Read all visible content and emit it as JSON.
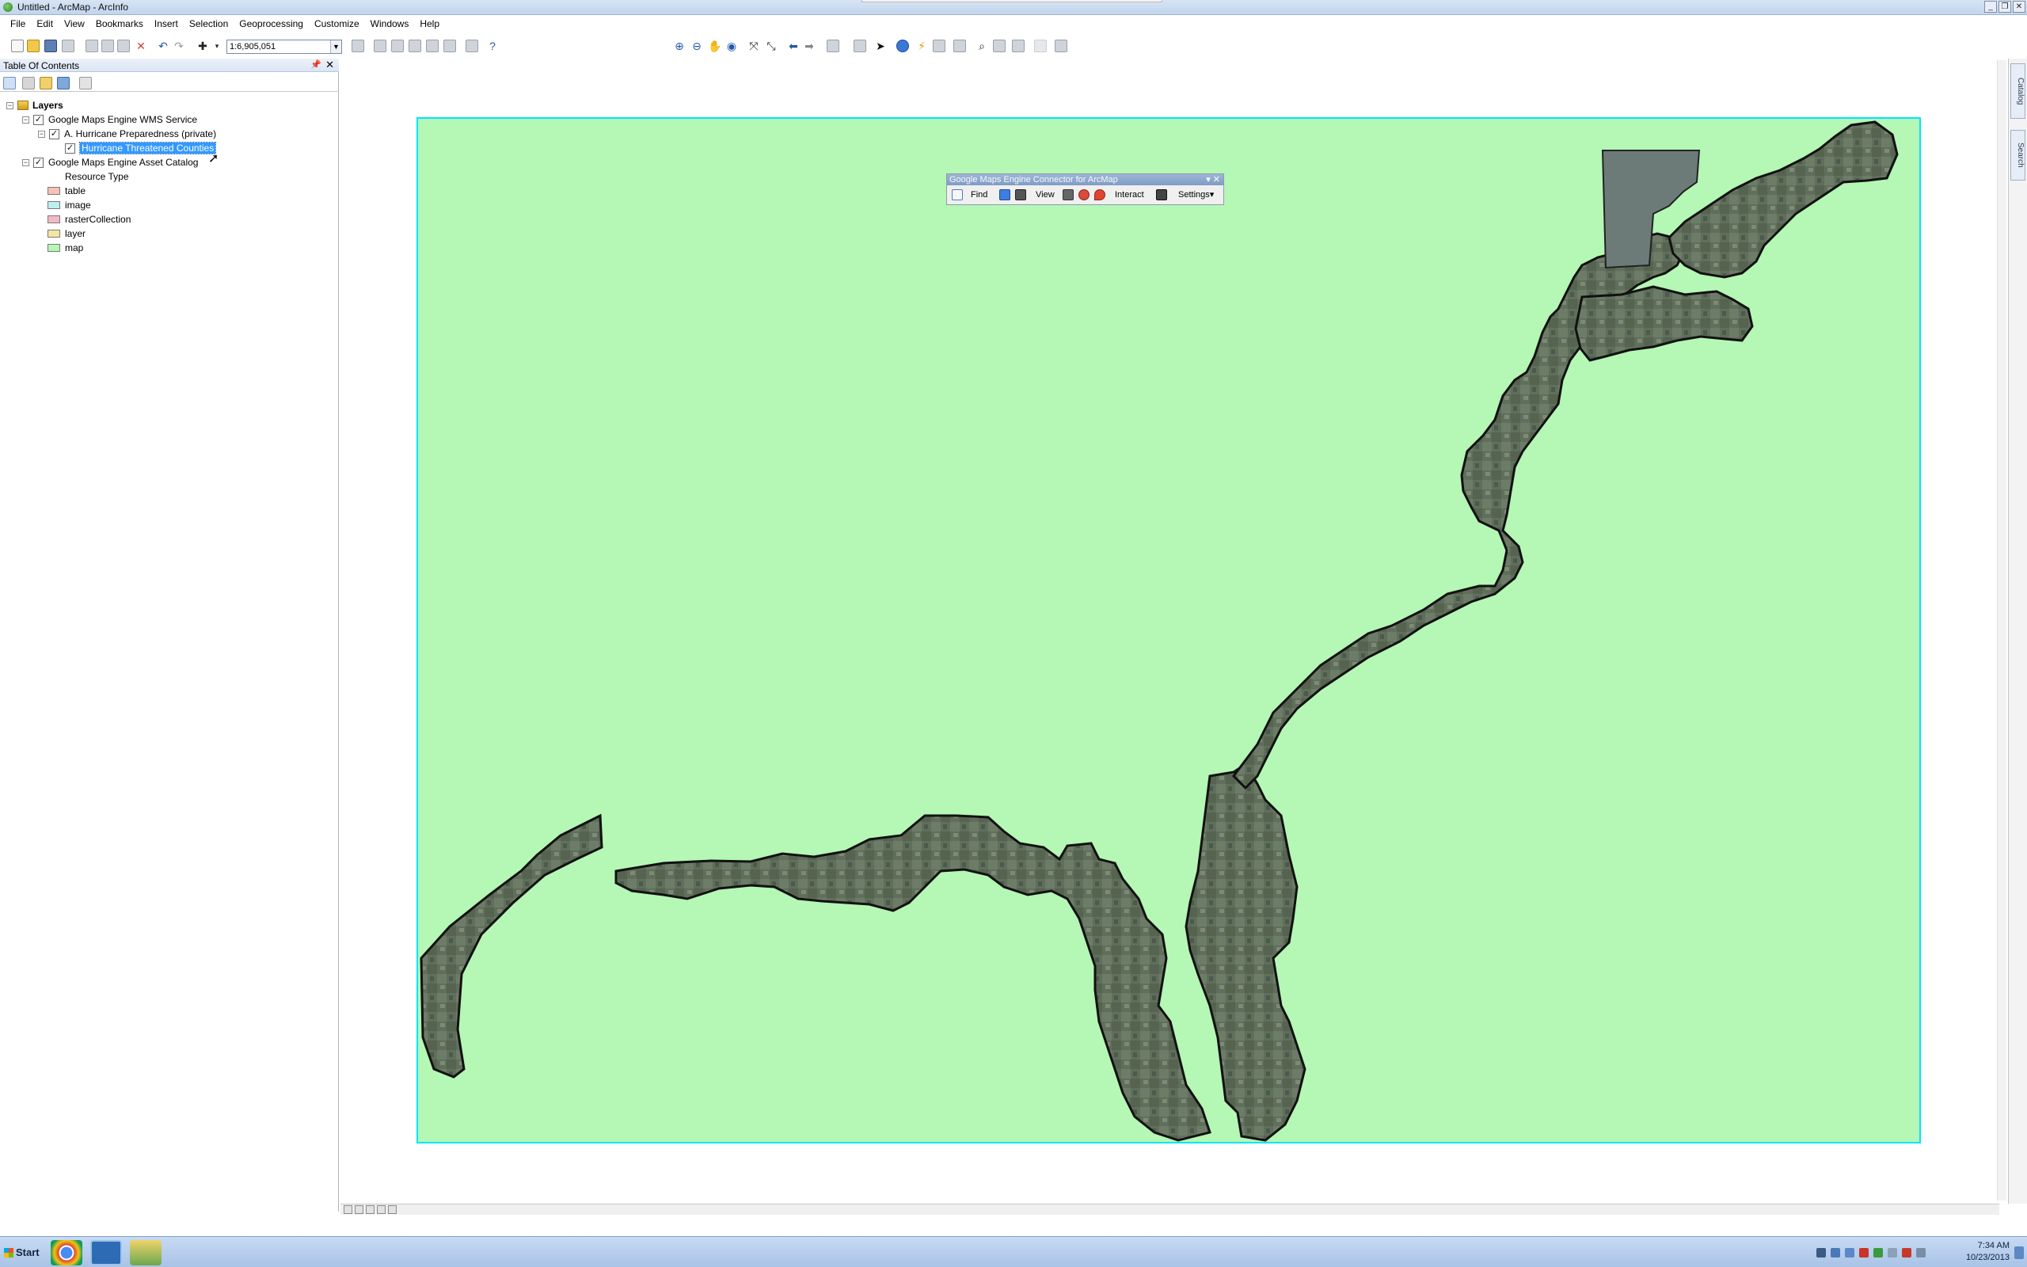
{
  "window": {
    "title": "Untitled - ArcMap - ArcInfo"
  },
  "menu": [
    "File",
    "Edit",
    "View",
    "Bookmarks",
    "Insert",
    "Selection",
    "Geoprocessing",
    "Customize",
    "Windows",
    "Help"
  ],
  "toolbar": {
    "scale_value": "1:6,905,051"
  },
  "toc": {
    "title": "Table Of Contents",
    "root_label": "Layers",
    "wms_service": "Google Maps Engine WMS Service",
    "group_layer": "A. Hurricane Preparedness (private)",
    "selected_layer": "Hurricane Threatened Counties",
    "asset_catalog": "Google Maps Engine Asset Catalog",
    "resource_type_label": "Resource Type",
    "legend": [
      {
        "label": "table",
        "color": "#f5c2b5"
      },
      {
        "label": "image",
        "color": "#bdeff2"
      },
      {
        "label": "rasterCollection",
        "color": "#f3b8c3"
      },
      {
        "label": "layer",
        "color": "#f3e5a3"
      },
      {
        "label": "map",
        "color": "#b5f7b5"
      }
    ]
  },
  "gme_toolbar": {
    "title": "Google Maps Engine Connector for ArcMap",
    "find": "Find",
    "view": "View",
    "interact": "Interact",
    "settings": "Settings"
  },
  "right_dock": {
    "tabs": [
      "Catalog",
      "Search"
    ]
  },
  "map": {
    "background_color": "#b5f7b5",
    "frame_color": "#00e5ff"
  },
  "taskbar": {
    "start": "Start",
    "time": "7:34 AM",
    "date": "10/23/2013"
  }
}
